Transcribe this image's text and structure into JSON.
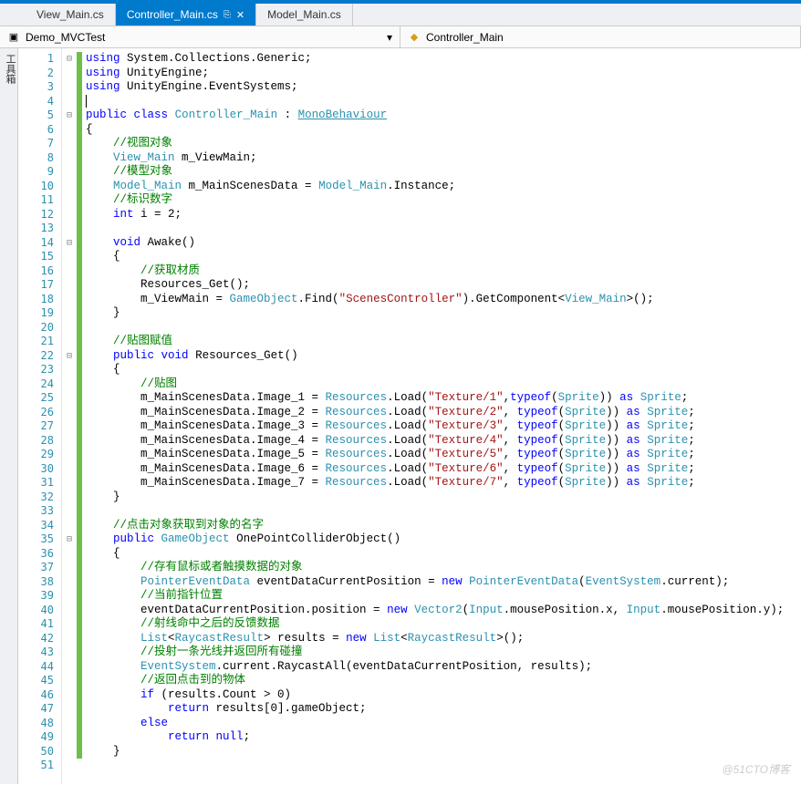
{
  "tabs": [
    {
      "label": "View_Main.cs",
      "active": false
    },
    {
      "label": "Controller_Main.cs",
      "active": true
    },
    {
      "label": "Model_Main.cs",
      "active": false
    }
  ],
  "nav": {
    "left": "Demo_MVCTest",
    "right": "Controller_Main"
  },
  "sideTab": "工具箱",
  "watermark": "@51CTO博客",
  "lines": [
    {
      "n": 1,
      "fold": "⊟",
      "chg": true,
      "tok": [
        [
          "kw",
          "using"
        ],
        [
          "txt",
          " System.Collections.Generic;"
        ]
      ]
    },
    {
      "n": 2,
      "fold": "",
      "chg": true,
      "tok": [
        [
          "kw",
          "using"
        ],
        [
          "txt",
          " UnityEngine;"
        ]
      ]
    },
    {
      "n": 3,
      "fold": "",
      "chg": true,
      "tok": [
        [
          "kw",
          "using"
        ],
        [
          "txt",
          " UnityEngine.EventSystems;"
        ]
      ]
    },
    {
      "n": 4,
      "fold": "",
      "chg": true,
      "caret": true,
      "tok": [
        [
          "txt",
          ""
        ]
      ]
    },
    {
      "n": 5,
      "fold": "⊟",
      "chg": true,
      "tok": [
        [
          "kw",
          "public"
        ],
        [
          "txt",
          " "
        ],
        [
          "kw",
          "class"
        ],
        [
          "txt",
          " "
        ],
        [
          "type",
          "Controller_Main"
        ],
        [
          "txt",
          " : "
        ],
        [
          "typeul",
          "MonoBehaviour"
        ]
      ]
    },
    {
      "n": 6,
      "fold": "",
      "chg": true,
      "tok": [
        [
          "txt",
          "{"
        ]
      ]
    },
    {
      "n": 7,
      "fold": "",
      "chg": true,
      "tok": [
        [
          "txt",
          "    "
        ],
        [
          "com",
          "//视图对象"
        ]
      ]
    },
    {
      "n": 8,
      "fold": "",
      "chg": true,
      "tok": [
        [
          "txt",
          "    "
        ],
        [
          "type",
          "View_Main"
        ],
        [
          "txt",
          " m_ViewMain;"
        ]
      ]
    },
    {
      "n": 9,
      "fold": "",
      "chg": true,
      "tok": [
        [
          "txt",
          "    "
        ],
        [
          "com",
          "//模型对象"
        ]
      ]
    },
    {
      "n": 10,
      "fold": "",
      "chg": true,
      "tok": [
        [
          "txt",
          "    "
        ],
        [
          "type",
          "Model_Main"
        ],
        [
          "txt",
          " m_MainScenesData = "
        ],
        [
          "type",
          "Model_Main"
        ],
        [
          "txt",
          ".Instance;"
        ]
      ]
    },
    {
      "n": 11,
      "fold": "",
      "chg": true,
      "tok": [
        [
          "txt",
          "    "
        ],
        [
          "com",
          "//标识数字"
        ]
      ]
    },
    {
      "n": 12,
      "fold": "",
      "chg": true,
      "tok": [
        [
          "txt",
          "    "
        ],
        [
          "kw",
          "int"
        ],
        [
          "txt",
          " i = 2;"
        ]
      ]
    },
    {
      "n": 13,
      "fold": "",
      "chg": true,
      "tok": [
        [
          "txt",
          ""
        ]
      ]
    },
    {
      "n": 14,
      "fold": "⊟",
      "chg": true,
      "tok": [
        [
          "txt",
          "    "
        ],
        [
          "kw",
          "void"
        ],
        [
          "txt",
          " Awake()"
        ]
      ]
    },
    {
      "n": 15,
      "fold": "",
      "chg": true,
      "tok": [
        [
          "txt",
          "    {"
        ]
      ]
    },
    {
      "n": 16,
      "fold": "",
      "chg": true,
      "tok": [
        [
          "txt",
          "        "
        ],
        [
          "com",
          "//获取材质"
        ]
      ]
    },
    {
      "n": 17,
      "fold": "",
      "chg": true,
      "tok": [
        [
          "txt",
          "        Resources_Get();"
        ]
      ]
    },
    {
      "n": 18,
      "fold": "",
      "chg": true,
      "tok": [
        [
          "txt",
          "        m_ViewMain = "
        ],
        [
          "type",
          "GameObject"
        ],
        [
          "txt",
          ".Find("
        ],
        [
          "str",
          "\"ScenesController\""
        ],
        [
          "txt",
          ").GetComponent<"
        ],
        [
          "type",
          "View_Main"
        ],
        [
          "txt",
          ">();"
        ]
      ]
    },
    {
      "n": 19,
      "fold": "",
      "chg": true,
      "tok": [
        [
          "txt",
          "    }"
        ]
      ]
    },
    {
      "n": 20,
      "fold": "",
      "chg": true,
      "tok": [
        [
          "txt",
          ""
        ]
      ]
    },
    {
      "n": 21,
      "fold": "",
      "chg": true,
      "tok": [
        [
          "txt",
          "    "
        ],
        [
          "com",
          "//贴图赋值"
        ]
      ]
    },
    {
      "n": 22,
      "fold": "⊟",
      "chg": true,
      "tok": [
        [
          "txt",
          "    "
        ],
        [
          "kw",
          "public"
        ],
        [
          "txt",
          " "
        ],
        [
          "kw",
          "void"
        ],
        [
          "txt",
          " Resources_Get()"
        ]
      ]
    },
    {
      "n": 23,
      "fold": "",
      "chg": true,
      "tok": [
        [
          "txt",
          "    {"
        ]
      ]
    },
    {
      "n": 24,
      "fold": "",
      "chg": true,
      "tok": [
        [
          "txt",
          "        "
        ],
        [
          "com",
          "//贴图"
        ]
      ]
    },
    {
      "n": 25,
      "fold": "",
      "chg": true,
      "tok": [
        [
          "txt",
          "        m_MainScenesData.Image_1 = "
        ],
        [
          "type",
          "Resources"
        ],
        [
          "txt",
          ".Load("
        ],
        [
          "str",
          "\"Texture/1\""
        ],
        [
          "txt",
          ","
        ],
        [
          "kw",
          "typeof"
        ],
        [
          "txt",
          "("
        ],
        [
          "type",
          "Sprite"
        ],
        [
          "txt",
          ")) "
        ],
        [
          "kw",
          "as"
        ],
        [
          "txt",
          " "
        ],
        [
          "type",
          "Sprite"
        ],
        [
          "txt",
          ";"
        ]
      ]
    },
    {
      "n": 26,
      "fold": "",
      "chg": true,
      "tok": [
        [
          "txt",
          "        m_MainScenesData.Image_2 = "
        ],
        [
          "type",
          "Resources"
        ],
        [
          "txt",
          ".Load("
        ],
        [
          "str",
          "\"Texture/2\""
        ],
        [
          "txt",
          ", "
        ],
        [
          "kw",
          "typeof"
        ],
        [
          "txt",
          "("
        ],
        [
          "type",
          "Sprite"
        ],
        [
          "txt",
          ")) "
        ],
        [
          "kw",
          "as"
        ],
        [
          "txt",
          " "
        ],
        [
          "type",
          "Sprite"
        ],
        [
          "txt",
          ";"
        ]
      ]
    },
    {
      "n": 27,
      "fold": "",
      "chg": true,
      "tok": [
        [
          "txt",
          "        m_MainScenesData.Image_3 = "
        ],
        [
          "type",
          "Resources"
        ],
        [
          "txt",
          ".Load("
        ],
        [
          "str",
          "\"Texture/3\""
        ],
        [
          "txt",
          ", "
        ],
        [
          "kw",
          "typeof"
        ],
        [
          "txt",
          "("
        ],
        [
          "type",
          "Sprite"
        ],
        [
          "txt",
          ")) "
        ],
        [
          "kw",
          "as"
        ],
        [
          "txt",
          " "
        ],
        [
          "type",
          "Sprite"
        ],
        [
          "txt",
          ";"
        ]
      ]
    },
    {
      "n": 28,
      "fold": "",
      "chg": true,
      "tok": [
        [
          "txt",
          "        m_MainScenesData.Image_4 = "
        ],
        [
          "type",
          "Resources"
        ],
        [
          "txt",
          ".Load("
        ],
        [
          "str",
          "\"Texture/4\""
        ],
        [
          "txt",
          ", "
        ],
        [
          "kw",
          "typeof"
        ],
        [
          "txt",
          "("
        ],
        [
          "type",
          "Sprite"
        ],
        [
          "txt",
          ")) "
        ],
        [
          "kw",
          "as"
        ],
        [
          "txt",
          " "
        ],
        [
          "type",
          "Sprite"
        ],
        [
          "txt",
          ";"
        ]
      ]
    },
    {
      "n": 29,
      "fold": "",
      "chg": true,
      "tok": [
        [
          "txt",
          "        m_MainScenesData.Image_5 = "
        ],
        [
          "type",
          "Resources"
        ],
        [
          "txt",
          ".Load("
        ],
        [
          "str",
          "\"Texture/5\""
        ],
        [
          "txt",
          ", "
        ],
        [
          "kw",
          "typeof"
        ],
        [
          "txt",
          "("
        ],
        [
          "type",
          "Sprite"
        ],
        [
          "txt",
          ")) "
        ],
        [
          "kw",
          "as"
        ],
        [
          "txt",
          " "
        ],
        [
          "type",
          "Sprite"
        ],
        [
          "txt",
          ";"
        ]
      ]
    },
    {
      "n": 30,
      "fold": "",
      "chg": true,
      "tok": [
        [
          "txt",
          "        m_MainScenesData.Image_6 = "
        ],
        [
          "type",
          "Resources"
        ],
        [
          "txt",
          ".Load("
        ],
        [
          "str",
          "\"Texture/6\""
        ],
        [
          "txt",
          ", "
        ],
        [
          "kw",
          "typeof"
        ],
        [
          "txt",
          "("
        ],
        [
          "type",
          "Sprite"
        ],
        [
          "txt",
          ")) "
        ],
        [
          "kw",
          "as"
        ],
        [
          "txt",
          " "
        ],
        [
          "type",
          "Sprite"
        ],
        [
          "txt",
          ";"
        ]
      ]
    },
    {
      "n": 31,
      "fold": "",
      "chg": true,
      "tok": [
        [
          "txt",
          "        m_MainScenesData.Image_7 = "
        ],
        [
          "type",
          "Resources"
        ],
        [
          "txt",
          ".Load("
        ],
        [
          "str",
          "\"Texture/7\""
        ],
        [
          "txt",
          ", "
        ],
        [
          "kw",
          "typeof"
        ],
        [
          "txt",
          "("
        ],
        [
          "type",
          "Sprite"
        ],
        [
          "txt",
          ")) "
        ],
        [
          "kw",
          "as"
        ],
        [
          "txt",
          " "
        ],
        [
          "type",
          "Sprite"
        ],
        [
          "txt",
          ";"
        ]
      ]
    },
    {
      "n": 32,
      "fold": "",
      "chg": true,
      "tok": [
        [
          "txt",
          "    }"
        ]
      ]
    },
    {
      "n": 33,
      "fold": "",
      "chg": true,
      "tok": [
        [
          "txt",
          ""
        ]
      ]
    },
    {
      "n": 34,
      "fold": "",
      "chg": true,
      "tok": [
        [
          "txt",
          "    "
        ],
        [
          "com",
          "//点击对象获取到对象的名字"
        ]
      ]
    },
    {
      "n": 35,
      "fold": "⊟",
      "chg": true,
      "tok": [
        [
          "txt",
          "    "
        ],
        [
          "kw",
          "public"
        ],
        [
          "txt",
          " "
        ],
        [
          "type",
          "GameObject"
        ],
        [
          "txt",
          " OnePointColliderObject()"
        ]
      ]
    },
    {
      "n": 36,
      "fold": "",
      "chg": true,
      "tok": [
        [
          "txt",
          "    {"
        ]
      ]
    },
    {
      "n": 37,
      "fold": "",
      "chg": true,
      "tok": [
        [
          "txt",
          "        "
        ],
        [
          "com",
          "//存有鼠标或者触摸数据的对象"
        ]
      ]
    },
    {
      "n": 38,
      "fold": "",
      "chg": true,
      "tok": [
        [
          "txt",
          "        "
        ],
        [
          "type",
          "PointerEventData"
        ],
        [
          "txt",
          " eventDataCurrentPosition = "
        ],
        [
          "kw",
          "new"
        ],
        [
          "txt",
          " "
        ],
        [
          "type",
          "PointerEventData"
        ],
        [
          "txt",
          "("
        ],
        [
          "type",
          "EventSystem"
        ],
        [
          "txt",
          ".current);"
        ]
      ]
    },
    {
      "n": 39,
      "fold": "",
      "chg": true,
      "tok": [
        [
          "txt",
          "        "
        ],
        [
          "com",
          "//当前指针位置"
        ]
      ]
    },
    {
      "n": 40,
      "fold": "",
      "chg": true,
      "tok": [
        [
          "txt",
          "        eventDataCurrentPosition.position = "
        ],
        [
          "kw",
          "new"
        ],
        [
          "txt",
          " "
        ],
        [
          "type",
          "Vector2"
        ],
        [
          "txt",
          "("
        ],
        [
          "type",
          "Input"
        ],
        [
          "txt",
          ".mousePosition.x, "
        ],
        [
          "type",
          "Input"
        ],
        [
          "txt",
          ".mousePosition.y);"
        ]
      ]
    },
    {
      "n": 41,
      "fold": "",
      "chg": true,
      "tok": [
        [
          "txt",
          "        "
        ],
        [
          "com",
          "//射线命中之后的反馈数据"
        ]
      ]
    },
    {
      "n": 42,
      "fold": "",
      "chg": true,
      "tok": [
        [
          "txt",
          "        "
        ],
        [
          "type",
          "List"
        ],
        [
          "txt",
          "<"
        ],
        [
          "type",
          "RaycastResult"
        ],
        [
          "txt",
          "> results = "
        ],
        [
          "kw",
          "new"
        ],
        [
          "txt",
          " "
        ],
        [
          "type",
          "List"
        ],
        [
          "txt",
          "<"
        ],
        [
          "type",
          "RaycastResult"
        ],
        [
          "txt",
          ">();"
        ]
      ]
    },
    {
      "n": 43,
      "fold": "",
      "chg": true,
      "tok": [
        [
          "txt",
          "        "
        ],
        [
          "com",
          "//投射一条光线并返回所有碰撞"
        ]
      ]
    },
    {
      "n": 44,
      "fold": "",
      "chg": true,
      "tok": [
        [
          "txt",
          "        "
        ],
        [
          "type",
          "EventSystem"
        ],
        [
          "txt",
          ".current.RaycastAll(eventDataCurrentPosition, results);"
        ]
      ]
    },
    {
      "n": 45,
      "fold": "",
      "chg": true,
      "tok": [
        [
          "txt",
          "        "
        ],
        [
          "com",
          "//返回点击到的物体"
        ]
      ]
    },
    {
      "n": 46,
      "fold": "",
      "chg": true,
      "tok": [
        [
          "txt",
          "        "
        ],
        [
          "kw",
          "if"
        ],
        [
          "txt",
          " (results.Count > 0)"
        ]
      ]
    },
    {
      "n": 47,
      "fold": "",
      "chg": true,
      "tok": [
        [
          "txt",
          "            "
        ],
        [
          "kw",
          "return"
        ],
        [
          "txt",
          " results[0].gameObject;"
        ]
      ]
    },
    {
      "n": 48,
      "fold": "",
      "chg": true,
      "tok": [
        [
          "txt",
          "        "
        ],
        [
          "kw",
          "else"
        ]
      ]
    },
    {
      "n": 49,
      "fold": "",
      "chg": true,
      "tok": [
        [
          "txt",
          "            "
        ],
        [
          "kw",
          "return"
        ],
        [
          "txt",
          " "
        ],
        [
          "kw",
          "null"
        ],
        [
          "txt",
          ";"
        ]
      ]
    },
    {
      "n": 50,
      "fold": "",
      "chg": true,
      "tok": [
        [
          "txt",
          "    }"
        ]
      ]
    },
    {
      "n": 51,
      "fold": "",
      "chg": false,
      "tok": [
        [
          "txt",
          ""
        ]
      ]
    }
  ]
}
